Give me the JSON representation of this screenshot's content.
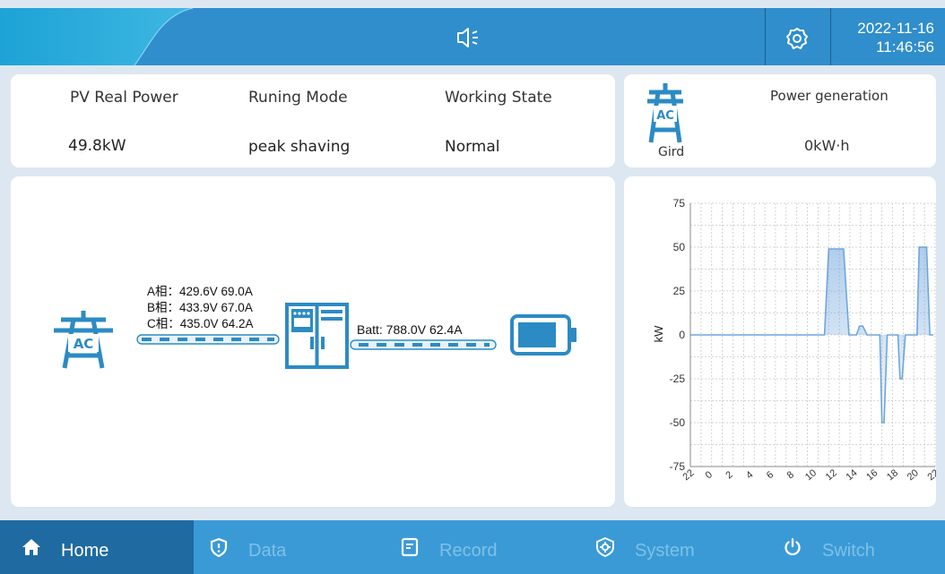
{
  "header": {
    "date": "2022-11-16",
    "time": "11:46:56",
    "speaker_icon": "speaker-mute-icon",
    "settings_icon": "gear-icon"
  },
  "summary": {
    "pv_label": "PV Real Power",
    "pv_value": "49.8kW",
    "mode_label": "Runing Mode",
    "mode_value": "peak shaving",
    "state_label": "Working State",
    "state_value": "Normal"
  },
  "grid": {
    "icon_text": "AC",
    "label": "Gird",
    "generation_label": "Power generation",
    "generation_value": "0kW·h"
  },
  "flow": {
    "grid_icon_text": "AC",
    "phase_a": "A相：429.6V 69.0A",
    "phase_b": "B相：433.9V 67.0A",
    "phase_c": "C相：435.0V 64.2A",
    "battery": "Batt:  788.0V   62.4A"
  },
  "chart_data": {
    "type": "area",
    "ylabel": "kW",
    "ylim": [
      -75,
      75
    ],
    "yticks": [
      "75",
      "50",
      "25",
      "0",
      "-25",
      "-50",
      "-75"
    ],
    "xticks": [
      "22",
      "0",
      "2",
      "4",
      "6",
      "8",
      "10",
      "12",
      "14",
      "16",
      "18",
      "20",
      "22"
    ],
    "grid": true,
    "color": "#6ea6dc",
    "series": [
      {
        "x": [
          0,
          12.6,
          13,
          14.4,
          14.9,
          15.6,
          15.9,
          16.2,
          16.6,
          17.8,
          18,
          18.2,
          18.5,
          19.5,
          19.7,
          19.9,
          20.2,
          21.3,
          21.5,
          22.2,
          22.5,
          22.8
        ],
        "values": [
          0,
          0,
          49,
          49,
          0,
          0,
          5,
          5,
          0,
          0,
          -50,
          -50,
          0,
          0,
          -25,
          -25,
          0,
          0,
          50,
          50,
          0,
          0
        ]
      }
    ]
  },
  "nav": {
    "items": [
      {
        "label": "Home",
        "icon": "home-icon"
      },
      {
        "label": "Data",
        "icon": "shield-icon"
      },
      {
        "label": "Record",
        "icon": "document-icon"
      },
      {
        "label": "System",
        "icon": "gear-shield-icon"
      },
      {
        "label": "Switch",
        "icon": "power-icon"
      }
    ]
  }
}
